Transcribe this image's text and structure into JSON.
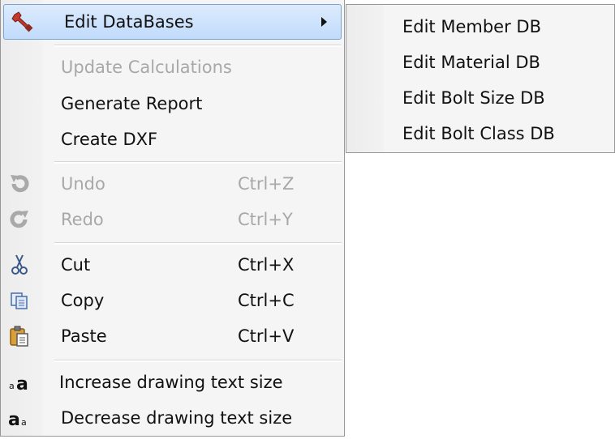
{
  "menu": {
    "edit_databases": "Edit DataBases",
    "update_calculations": "Update Calculations",
    "generate_report": "Generate Report",
    "create_dxf": "Create DXF",
    "undo": {
      "label": "Undo",
      "shortcut": "Ctrl+Z"
    },
    "redo": {
      "label": "Redo",
      "shortcut": "Ctrl+Y"
    },
    "cut": {
      "label": "Cut",
      "shortcut": "Ctrl+X"
    },
    "copy": {
      "label": "Copy",
      "shortcut": "Ctrl+C"
    },
    "paste": {
      "label": "Paste",
      "shortcut": "Ctrl+V"
    },
    "increase_text": "Increase drawing text size",
    "decrease_text": "Decrease drawing text size"
  },
  "submenu": {
    "items": [
      "Edit Member DB",
      "Edit Material DB",
      "Edit Bolt Size DB",
      "Edit Bolt Class DB"
    ]
  },
  "icons": {
    "edit_databases": "wrench-icon",
    "undo": "undo-icon",
    "redo": "redo-icon",
    "cut": "scissors-icon",
    "copy": "copy-icon",
    "paste": "paste-icon",
    "increase_text": "increase-text-size-icon",
    "decrease_text": "decrease-text-size-icon"
  },
  "colors": {
    "highlight_top": "#dcebfc",
    "highlight_bottom": "#c1dbfc",
    "highlight_border": "#7da2ce",
    "disabled_text": "#a8a8a8",
    "wrench_red": "#c0392b"
  }
}
